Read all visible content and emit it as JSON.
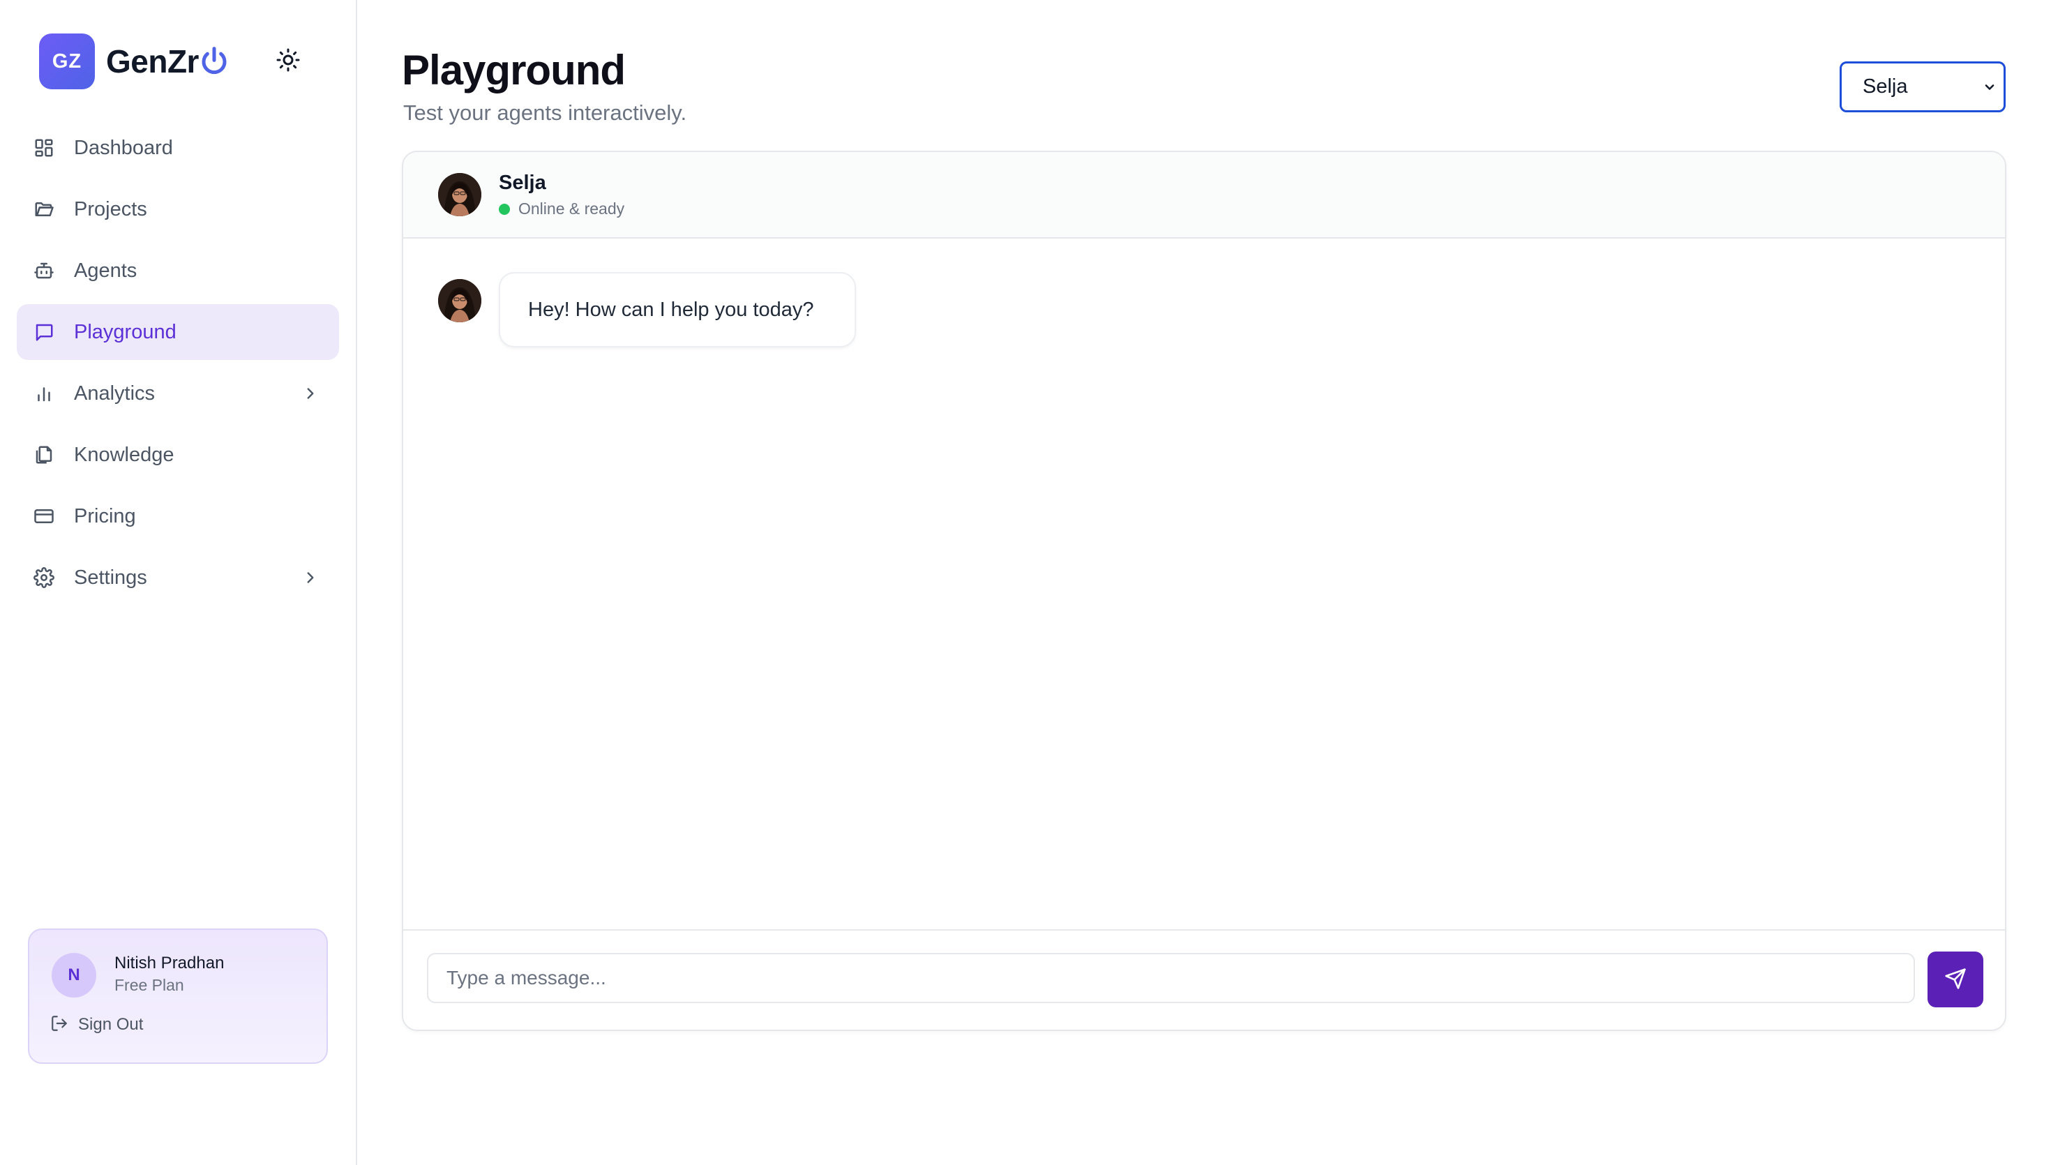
{
  "brand": {
    "badge": "GZ",
    "name": "GenZr",
    "accent_color": "#5b30d6",
    "logo_icon": "power-icon"
  },
  "theme_toggle": {
    "icon": "sun-icon"
  },
  "sidebar": {
    "items": [
      {
        "label": "Dashboard",
        "icon": "dashboard-icon",
        "active": false,
        "has_children": false
      },
      {
        "label": "Projects",
        "icon": "folder-icon",
        "active": false,
        "has_children": false
      },
      {
        "label": "Agents",
        "icon": "bot-icon",
        "active": false,
        "has_children": false
      },
      {
        "label": "Playground",
        "icon": "chat-icon",
        "active": true,
        "has_children": false
      },
      {
        "label": "Analytics",
        "icon": "bar-chart-icon",
        "active": false,
        "has_children": true
      },
      {
        "label": "Knowledge",
        "icon": "files-icon",
        "active": false,
        "has_children": false
      },
      {
        "label": "Pricing",
        "icon": "credit-card-icon",
        "active": false,
        "has_children": false
      },
      {
        "label": "Settings",
        "icon": "gear-icon",
        "active": false,
        "has_children": true
      }
    ]
  },
  "user": {
    "initial": "N",
    "name": "Nitish Pradhan",
    "plan": "Free Plan",
    "sign_out_label": "Sign Out"
  },
  "page": {
    "title": "Playground",
    "subtitle": "Test your agents interactively."
  },
  "agent_select": {
    "selected": "Selja"
  },
  "chat": {
    "agent_name": "Selja",
    "status": "Online & ready",
    "status_color": "#22c55e",
    "messages": [
      {
        "sender": "agent",
        "text": "Hey! How can I help you today?"
      }
    ],
    "input": {
      "value": "",
      "placeholder": "Type a message..."
    },
    "send_icon": "send-icon",
    "send_button_color": "#5b21b6"
  }
}
